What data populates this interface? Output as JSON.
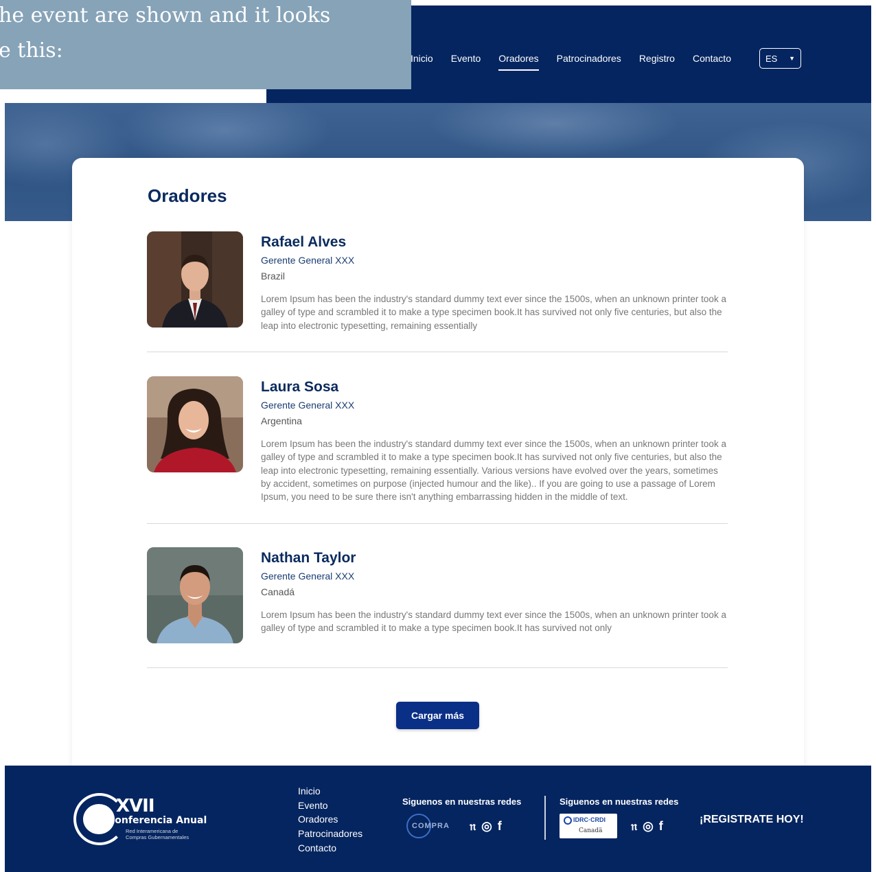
{
  "caption": {
    "line1": "he event are shown and it looks",
    "line2": "e this:"
  },
  "nav": {
    "items": [
      {
        "label": "Inicio"
      },
      {
        "label": "Evento"
      },
      {
        "label": "Oradores"
      },
      {
        "label": "Patrocinadores"
      },
      {
        "label": "Registro"
      },
      {
        "label": "Contacto"
      }
    ],
    "active": "Oradores",
    "language": "ES"
  },
  "section_title": "Oradores",
  "speakers": [
    {
      "name": "Rafael Alves",
      "role": "Gerente General XXX",
      "country": "Brazil",
      "bio": "Lorem Ipsum has been the industry's standard dummy text ever since the 1500s, when an unknown printer took a galley of type and scrambled it to make a type specimen book.It has survived not only five centuries, but also the leap into electronic typesetting, remaining essentially"
    },
    {
      "name": "Laura Sosa",
      "role": "Gerente General XXX",
      "country": "Argentina",
      "bio": "Lorem Ipsum has been the industry's standard dummy text ever since the 1500s, when an unknown printer took a galley of type and scrambled it to make a type specimen book.It has survived not only five centuries, but also the leap into electronic typesetting, remaining essentially. Various versions have evolved over the years, sometimes by accident, sometimes on purpose (injected humour and the like).. If you are going to use a passage of Lorem Ipsum, you need to be sure there isn't anything embarrassing hidden in the middle of text."
    },
    {
      "name": "Nathan Taylor",
      "role": "Gerente General XXX",
      "country": "Canadá",
      "bio": "Lorem Ipsum has been the industry's standard dummy text ever since the 1500s, when an unknown printer took a galley of type and scrambled it to make a type specimen book.It has survived not only"
    }
  ],
  "load_more_label": "Cargar más",
  "footer": {
    "logo": {
      "number": "XVII",
      "title": "Conferencia Anual",
      "subtitle1": "Red Interamericana de",
      "subtitle2": "Compras Gubernamentales"
    },
    "nav": [
      "Inicio",
      "Evento",
      "Oradores",
      "Patrocinadores",
      "Contacto"
    ],
    "social_title_1": "Siguenos en nuestras redes",
    "social_title_2": "Siguenos en nuestras redes",
    "partner1_text": "COMPRA",
    "partner2_text1": "IDRC·CRDI",
    "partner2_text2": "Canadä",
    "icons": [
      "twitter-icon",
      "instagram-icon",
      "facebook-icon"
    ],
    "register_label": "¡REGISTRATE HOY!"
  },
  "colors": {
    "navy": "#052560",
    "title": "#0a2a5e",
    "button": "#0a2f87",
    "caption_bg": "#86a3b8"
  }
}
